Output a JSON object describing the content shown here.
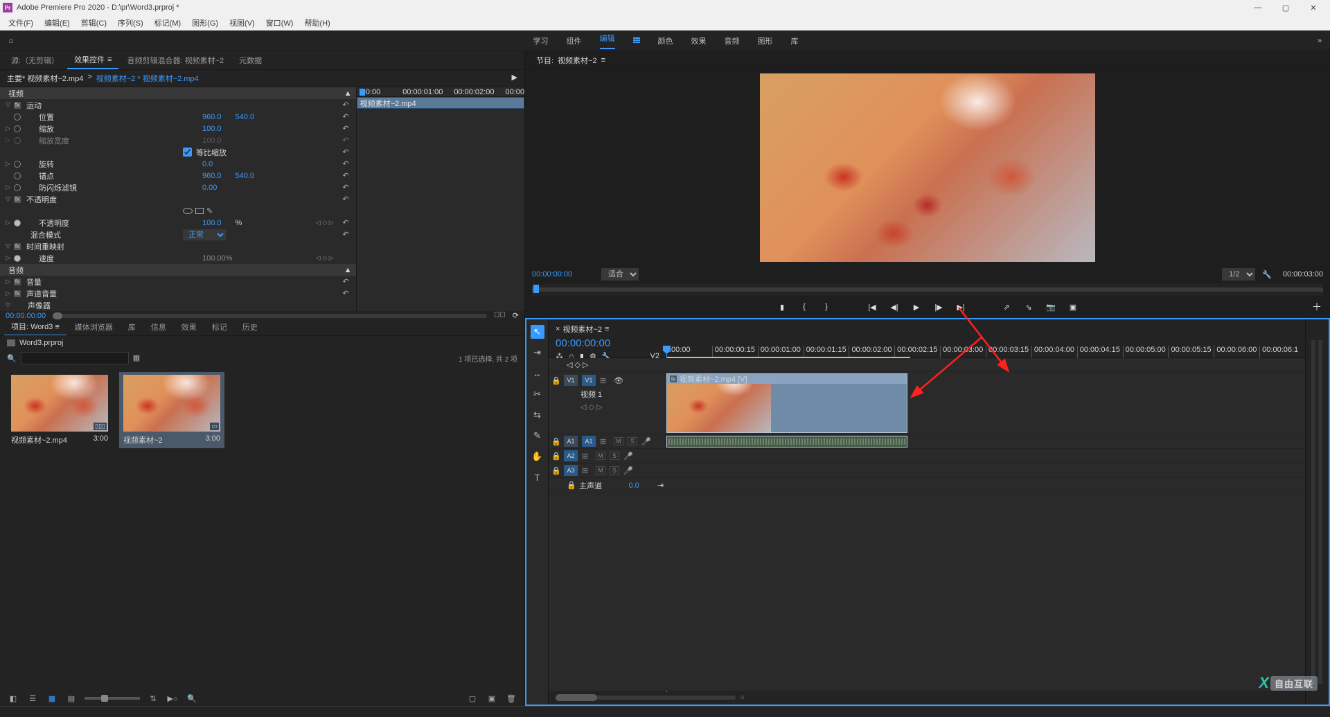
{
  "app": {
    "title": "Adobe Premiere Pro 2020 - D:\\pr\\Word3.prproj *"
  },
  "menu": [
    "文件(F)",
    "编辑(E)",
    "剪辑(C)",
    "序列(S)",
    "标记(M)",
    "图形(G)",
    "视图(V)",
    "窗口(W)",
    "帮助(H)"
  ],
  "workspaces": {
    "items": [
      "学习",
      "组件",
      "编辑",
      "颜色",
      "效果",
      "音频",
      "图形",
      "库"
    ],
    "active": "编辑"
  },
  "source_tabs": {
    "items": [
      "源:（无剪辑）",
      "效果控件",
      "音频剪辑混合器: 视频素材~2",
      "元数据"
    ],
    "active": "效果控件"
  },
  "fx": {
    "crumb_main": "主要* 视频素材~2.mp4",
    "crumb_link": "视频素材~2 * 视频素材~2.mp4",
    "video_header": "视频",
    "clipbar": "视频素材~2.mp4",
    "motion": {
      "label": "运动",
      "position_label": "位置",
      "position_x": "960.0",
      "position_y": "540.0",
      "scale_label": "缩放",
      "scale_val": "100.0",
      "scalew_label": "缩放宽度",
      "scalew_val": "100.0",
      "uniform_label": "等比缩放",
      "rotation_label": "旋转",
      "rotation_val": "0.0",
      "anchor_label": "锚点",
      "anchor_x": "960.0",
      "anchor_y": "540.0",
      "flicker_label": "防闪烁滤镜",
      "flicker_val": "0.00"
    },
    "opacity": {
      "label": "不透明度",
      "pct_label": "不透明度",
      "pct_val": "100.0",
      "pct_unit": "%",
      "blend_label": "混合模式",
      "blend_val": "正常"
    },
    "remap": {
      "label": "时间重映射",
      "speed_label": "速度",
      "speed_val": "100.00%"
    },
    "audio_header": "音频",
    "volume": "音量",
    "channel_volume": "声道音量",
    "panner": "声像器",
    "ruler": [
      ":00:00",
      "00:00:01:00",
      "00:00:02:00",
      "00:00"
    ],
    "footer_tc": "00:00:00:00"
  },
  "program": {
    "tab_prefix": "节目:",
    "tab_name": "视频素材~2",
    "tc": "00:00:00:00",
    "fit": "适合",
    "res": "1/2",
    "duration": "00:00:03:00"
  },
  "project": {
    "tabs": [
      "项目: Word3",
      "媒体浏览器",
      "库",
      "信息",
      "效果",
      "标记",
      "历史"
    ],
    "active": "项目: Word3",
    "filename": "Word3.prproj",
    "search_placeholder": "",
    "status": "1 项已选择, 共 2 项",
    "items": [
      {
        "name": "视频素材~2.mp4",
        "dur": "3:00",
        "selected": false
      },
      {
        "name": "视频素材~2",
        "dur": "3:00",
        "selected": true
      }
    ]
  },
  "timeline": {
    "seq_name": "视频素材~2",
    "tc": "00:00:00:00",
    "v2label": "V2",
    "ruler": [
      ":00:00",
      "00:00:00:15",
      "00:00:01:00",
      "00:00:01:15",
      "00:00:02:00",
      "00:00:02:15",
      "00:00:03:00",
      "00:00:03:15",
      "00:00:04:00",
      "00:00:04:15",
      "00:00:05:00",
      "00:00:05:15",
      "00:00:06:00",
      "00:00:06:1"
    ],
    "v1": {
      "tag": "V1",
      "name": "视频 1"
    },
    "a1": "A1",
    "a2": "A2",
    "a3": "A3",
    "m": "M",
    "s": "S",
    "master": "主声道",
    "master_val": "0.0",
    "clip_title": "视频素材~2.mp4 [V]"
  },
  "watermark": "自由互联"
}
